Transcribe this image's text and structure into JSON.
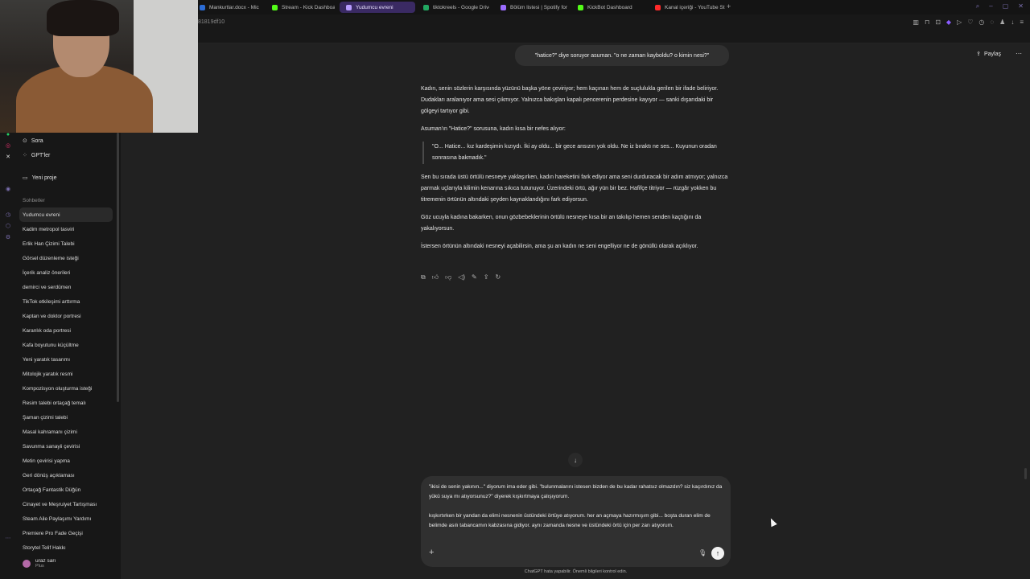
{
  "browser": {
    "tabs": [
      {
        "label": "Mankurtlar.docx - Micros",
        "color": "#2b6cd6"
      },
      {
        "label": "Stream - Kick Dashboard",
        "color": "#53fc18"
      },
      {
        "label": "Yudumcu evreni",
        "color": "#b89cff",
        "active": true
      },
      {
        "label": "tiktokreels - Google Drive",
        "color": "#22a861"
      },
      {
        "label": "Bölüm listesi | Spotify for",
        "color": "#9b6cff"
      },
      {
        "label": "KickBot Dashboard",
        "color": "#53fc18"
      },
      {
        "label": "Kanal içeriği - YouTube St",
        "color": "#ff2a2a"
      }
    ],
    "url_fragment": "81819df10"
  },
  "sidebar": {
    "nav": [
      {
        "icon": "⊙",
        "label": "Sora"
      },
      {
        "icon": "⁘",
        "label": "GPT'ler"
      },
      {
        "icon": "▭",
        "label": "Yeni proje"
      }
    ],
    "section_label": "Sohbetler",
    "chats": [
      "Yudumcu evreni",
      "Kadim metropol tasviri",
      "Erlik Han Çizimi Talebi",
      "Görsel düzenleme isteği",
      "İçerik analiz önerileri",
      "demirci ve serdümen",
      "TikTok etkileşimi arttırma",
      "Kaptan ve doktor portresi",
      "Karanlık oda portresi",
      "Kafa boyutunu küçültme",
      "Yeni yaratık tasarımı",
      "Mitolojik yaratık resmi",
      "Kompozisyon oluşturma isteği",
      "Resim talebi ortaçağ temalı",
      "Şaman çizimi talebi",
      "Masal kahramanı çizimi",
      "Savunma sanayii çevirisi",
      "Metin çevirisi yapma",
      "Geri dönüş açıklaması",
      "Ortaçağ Fantastik Düğün",
      "Cinayet ve Meşruiyet Tartışması",
      "Steam Aile Paylaşımı Yardımı",
      "Premiere Pro Fade Geçişi",
      "Storytel Telif Hakkı"
    ],
    "user": {
      "name": "uraz sarı",
      "plan": "Plus"
    }
  },
  "header": {
    "share_label": "Paylaş",
    "more_icon": "⋯"
  },
  "conversation": {
    "user_message": "\"hatice?\" diye soruyor asuman. \"o ne zaman kayboldu? o kimin nesi?\"",
    "assistant": {
      "p1": "Kadın, senin sözlerin karşısında yüzünü başka yöne çeviriyor; hem kaçınan hem de suçlulukla gerilen bir ifade beliriyor. Dudakları aralanıyor ama sesi çıkmıyor. Yalnızca bakışları kapalı pencerenin perdesine kayıyor — sanki dışarıdaki bir gölgeyi tartıyor gibi.",
      "p2": "Asuman'ın \"Hatice?\" sorusuna, kadın kısa bir nefes alıyor:",
      "quote": "\"O... Hatice... kız kardeşimin kızıydı. İki ay oldu... bir gece ansızın yok oldu. Ne iz bıraktı ne ses... Kuyunun oradan sonrasına bakmadık.\"",
      "p3": "Sen bu sırada üstü örtülü nesneye yaklaşırken, kadın hareketini fark ediyor ama seni durduracak bir adım atmıyor; yalnızca parmak uçlarıyla kilimin kenarına sıkıca tutunuyor. Üzerindeki örtü, ağır yün bir bez. Hafifçe titriyor — rüzgâr yokken bu titremenin örtünün altındaki şeyden kaynaklandığını fark ediyorsun.",
      "p4": "Göz ucuyla kadına bakarken, onun gözbebeklerinin örtülü nesneye kısa bir an takılıp hemen senden kaçtığını da yakalıyorsun.",
      "p5": "İstersen örtünün altındaki nesneyi açabilirsin, ama şu an kadın ne seni engelliyor ne de gönüllü olarak açıklıyor."
    }
  },
  "composer": {
    "text": "\"ikisi de senin yakının...\" diyorum ima eder gibi. \"bulunmalarını istesen bizden de bu kadar rahatsız olmazdın? siz kaçırdınız da yükü suya mı atıyorsunuz?\" diyerek kışkırtmaya çalışıyorum.\n\nkışkırtırken bir yandan da elimi nesnenin üstündeki örtüye atıyorum. her an açmaya hazırmışım gibi... boşta duran elim de belimde asılı tabancamın kabzasına gidiyor. aynı zamanda nesne ve üstündeki örtü için per zarı atıyorum.",
    "disclaimer": "ChatGPT hata yapabilir. Önemli bilgileri kontrol edin."
  }
}
